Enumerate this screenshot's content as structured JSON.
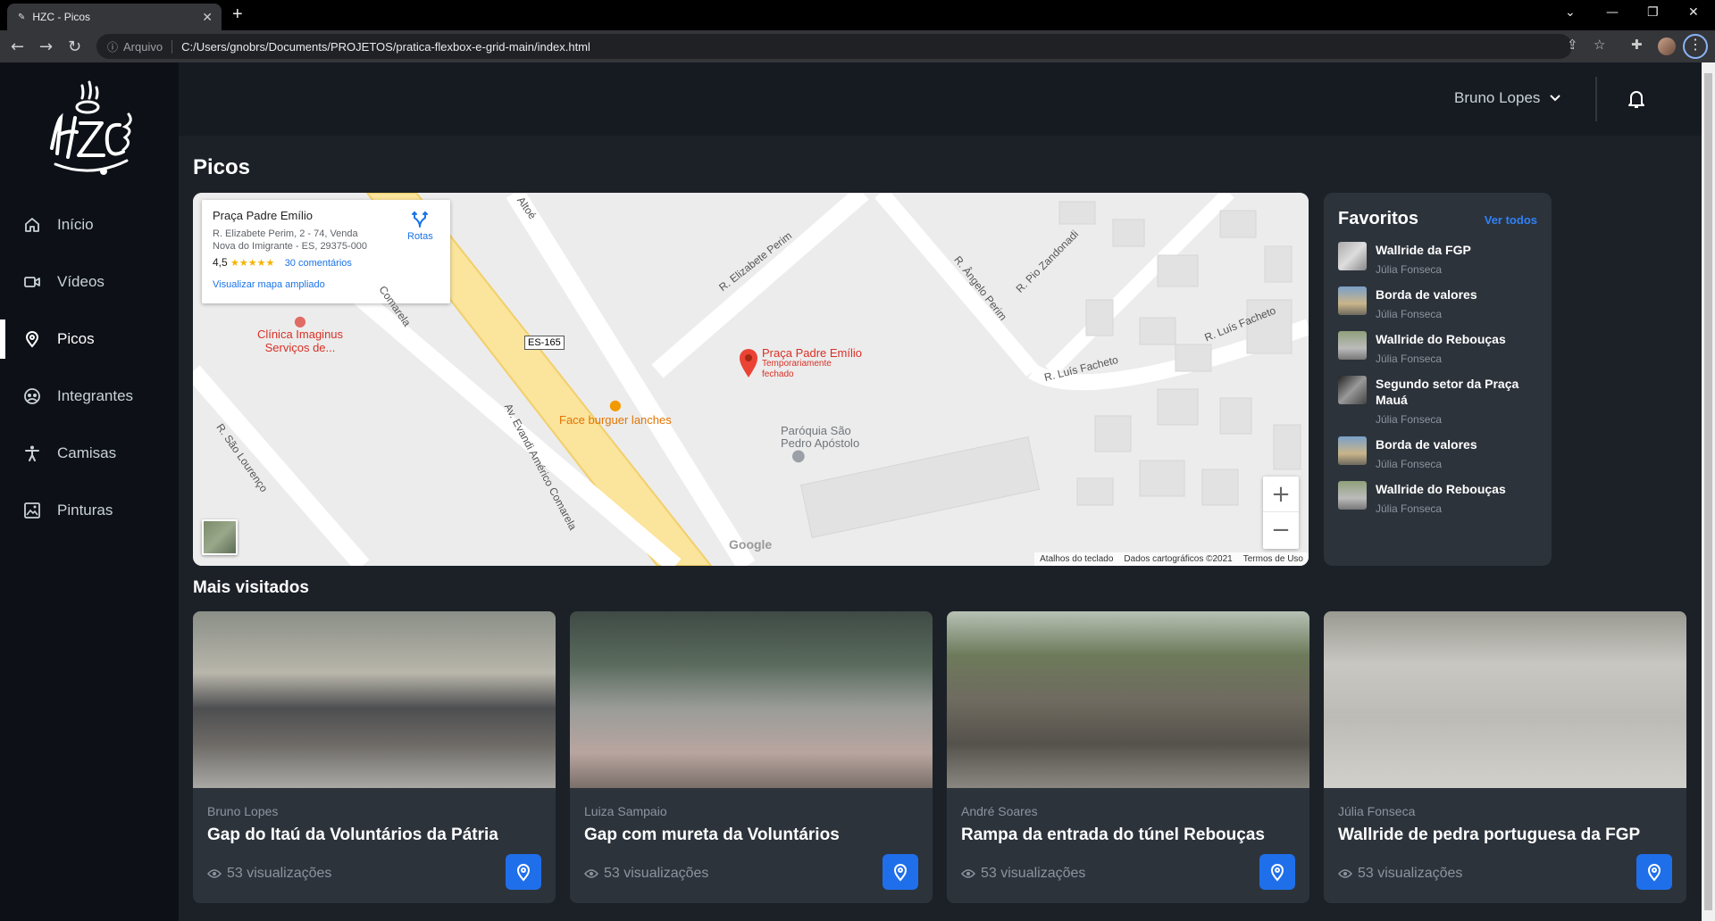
{
  "browser": {
    "tab_title": "HZC - Picos",
    "security_label": "Arquivo",
    "url": "C:/Users/gnobrs/Documents/PROJETOS/pratica-flexbox-e-grid-main/index.html"
  },
  "app": {
    "logo_text": "HZC",
    "sidebar": {
      "items": [
        {
          "label": "Início",
          "icon": "home-icon"
        },
        {
          "label": "Vídeos",
          "icon": "video-icon"
        },
        {
          "label": "Picos",
          "icon": "map-pin-icon",
          "active": true
        },
        {
          "label": "Integrantes",
          "icon": "users-icon"
        },
        {
          "label": "Camisas",
          "icon": "person-icon"
        },
        {
          "label": "Pinturas",
          "icon": "image-icon"
        }
      ]
    },
    "header": {
      "user_name": "Bruno Lopes"
    },
    "page_title": "Picos",
    "map": {
      "place_name": "Praça Padre Emílio",
      "address": "R. Elizabete Perim, 2 - 74, Venda Nova do Imigrante - ES, 29375-000",
      "rating": "4,5",
      "stars": "★★★★★",
      "reviews_link": "30 comentários",
      "directions_label": "Rotas",
      "enlarge_link": "Visualizar mapa ampliado",
      "pin_label": "Praça Padre Emílio",
      "pin_sub": "Temporariamente fechado",
      "labels": {
        "clinic": "Clínica Imaginus Serviços de...",
        "burger": "Face burguer lanches",
        "church": "Paróquia São Pedro Apóstolo",
        "road_es": "ES-165",
        "st_elizabete": "R. Elizabete Perim",
        "st_angelo": "R. Ângelo Perim",
        "st_pio": "R. Pio Zandonadi",
        "st_luis1": "R. Luís Facheto",
        "st_luis2": "R. Luís Facheto",
        "st_sao_lourenco": "R. São Lourenço",
        "st_evandi": "Av. Evandi Américo Comarela",
        "st_comarela": "Comarela",
        "st_altoe": "Altoé"
      },
      "google": "Google",
      "footer": [
        "Atalhos do teclado",
        "Dados cartográficos ©2021",
        "Termos de Uso"
      ],
      "zoom_in": "+",
      "zoom_out": "−"
    },
    "favorites": {
      "title": "Favoritos",
      "see_all": "Ver todos",
      "items": [
        {
          "title": "Wallride da FGP",
          "author": "Júlia Fonseca"
        },
        {
          "title": "Borda de valores",
          "author": "Júlia Fonseca"
        },
        {
          "title": "Wallride do Rebouças",
          "author": "Júlia Fonseca"
        },
        {
          "title": "Segundo setor da Praça Mauá",
          "author": "Júlia Fonseca"
        },
        {
          "title": "Borda de valores",
          "author": "Júlia Fonseca"
        },
        {
          "title": "Wallride do Rebouças",
          "author": "Júlia Fonseca"
        }
      ]
    },
    "most_visited": {
      "title": "Mais visitados",
      "cards": [
        {
          "author": "Bruno Lopes",
          "title": "Gap do Itaú da Voluntários da Pátria",
          "views": "53 visualizações"
        },
        {
          "author": "Luiza Sampaio",
          "title": "Gap com mureta da Voluntários",
          "views": "53 visualizações"
        },
        {
          "author": "André Soares",
          "title": "Rampa da entrada do túnel Rebouças",
          "views": "53 visualizações"
        },
        {
          "author": "Júlia Fonseca",
          "title": "Wallride de pedra portuguesa da FGP",
          "views": "53 visualizações"
        }
      ]
    }
  }
}
